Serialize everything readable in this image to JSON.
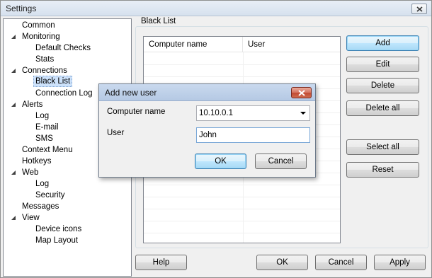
{
  "window": {
    "title": "Settings"
  },
  "tree": {
    "items": [
      {
        "label": "Common"
      },
      {
        "label": "Monitoring"
      },
      {
        "label": "Default Checks"
      },
      {
        "label": "Stats"
      },
      {
        "label": "Connections"
      },
      {
        "label": "Black List"
      },
      {
        "label": "Connection Log"
      },
      {
        "label": "Alerts"
      },
      {
        "label": "Log"
      },
      {
        "label": "E-mail"
      },
      {
        "label": "SMS"
      },
      {
        "label": "Context Menu"
      },
      {
        "label": "Hotkeys"
      },
      {
        "label": "Web"
      },
      {
        "label": "Log"
      },
      {
        "label": "Security"
      },
      {
        "label": "Messages"
      },
      {
        "label": "View"
      },
      {
        "label": "Device icons"
      },
      {
        "label": "Map Layout"
      }
    ]
  },
  "blacklist": {
    "group_label": "Black List",
    "columns": [
      "Computer name",
      "User"
    ],
    "buttons": {
      "add": "Add",
      "edit": "Edit",
      "delete": "Delete",
      "delete_all": "Delete all",
      "select_all": "Select all",
      "reset": "Reset"
    }
  },
  "footer": {
    "help": "Help",
    "ok": "OK",
    "cancel": "Cancel",
    "apply": "Apply"
  },
  "dialog": {
    "title": "Add new user",
    "computer_name_label": "Computer name",
    "computer_name_value": "10.10.0.1",
    "user_label": "User",
    "user_value": "John",
    "ok": "OK",
    "cancel": "Cancel"
  }
}
